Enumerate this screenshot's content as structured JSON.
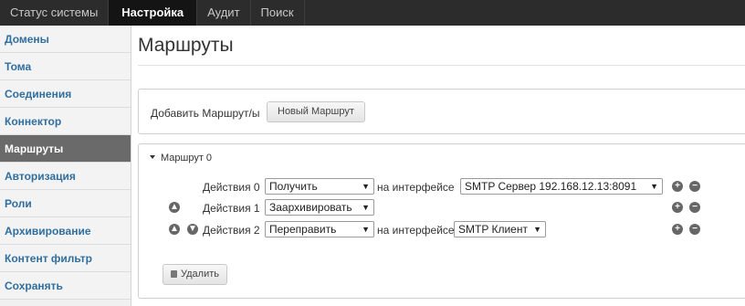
{
  "topnav": {
    "tabs": [
      {
        "label": "Статус системы"
      },
      {
        "label": "Настройка"
      },
      {
        "label": "Аудит"
      },
      {
        "label": "Поиск"
      }
    ],
    "active_index": 1
  },
  "sidebar": {
    "items": [
      {
        "label": "Домены"
      },
      {
        "label": "Тома"
      },
      {
        "label": "Соединения"
      },
      {
        "label": "Коннектор"
      },
      {
        "label": "Маршруты"
      },
      {
        "label": "Авторизация"
      },
      {
        "label": "Роли"
      },
      {
        "label": "Архивирование"
      },
      {
        "label": "Контент фильтр"
      },
      {
        "label": "Сохранять"
      }
    ],
    "active_index": 4
  },
  "main": {
    "title": "Маршруты",
    "add": {
      "label": "Добавить Маршрут/ы",
      "button": "Новый Маршрут"
    },
    "route": {
      "header": "Маршрут 0",
      "actions": [
        {
          "label": "Действия 0",
          "selected": "Получить",
          "iface_label": "на интерфейсе",
          "iface_selected": "SMTP Сервер 192.168.12.13:8091"
        },
        {
          "label": "Действия 1",
          "selected": "Заархивировать"
        },
        {
          "label": "Действия 2",
          "selected": "Переправить",
          "iface_label": "на интерфейсе",
          "iface_selected": "SMTP Клиент"
        }
      ],
      "delete_button": "Удалить"
    }
  },
  "colors": {
    "topnav_bg": "#2c2c2c",
    "link_blue": "#2f6f9f",
    "sidebar_active": "#6a6a6a"
  }
}
